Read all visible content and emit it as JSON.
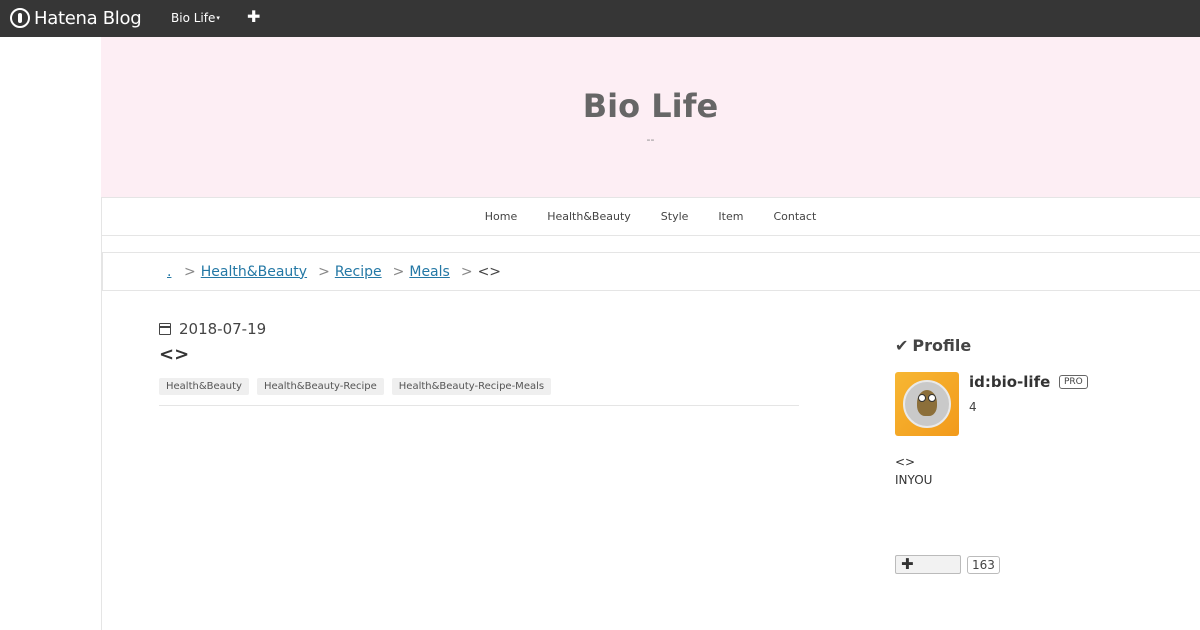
{
  "topbar": {
    "logo_text": "Hatena Blog",
    "blog_menu_label": "Bio Life",
    "caret": "▾",
    "plus": "✚"
  },
  "header": {
    "title": "Bio Life",
    "description": "--"
  },
  "nav": {
    "items": [
      "Home",
      "Health&Beauty",
      "Style",
      "Item",
      "Contact"
    ]
  },
  "breadcrumb": {
    "home": ".",
    "items": [
      "Health&Beauty",
      "Recipe",
      "Meals"
    ],
    "separator": ">",
    "current": "<>"
  },
  "entry": {
    "date": "2018-07-19",
    "title": "<>",
    "categories": [
      "Health&Beauty",
      "Health&Beauty-Recipe",
      "Health&Beauty-Recipe-Meals"
    ]
  },
  "sidebar": {
    "profile_heading": "Profile",
    "check": "✔",
    "user_id": "id:bio-life",
    "badge": "PRO",
    "count": "4",
    "desc_line1": "<>",
    "desc_line2": "INYOU",
    "star_plus": "✚",
    "star_count": "163"
  }
}
